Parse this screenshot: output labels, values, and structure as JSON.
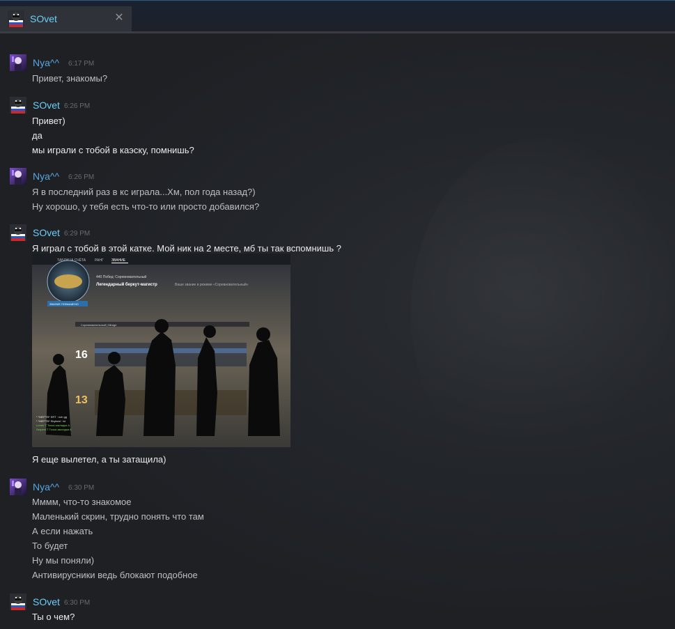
{
  "tab": {
    "name": "SOvet",
    "close_glyph": "✕",
    "avatar_icon": "sovet-avatar-icon"
  },
  "colors": {
    "nya_name": "#5aa6e0",
    "sovet_name": "#6dcff6",
    "background": "#1f2126"
  },
  "messages": [
    {
      "author": "Nya^^",
      "time": "6:17 PM",
      "lines": [
        "Привет, знакомы?"
      ]
    },
    {
      "author": "SOvet",
      "time": "6:26 PM",
      "lines": [
        "Привет)",
        "да",
        "мы играли с тобой в каэску, помнишь?"
      ]
    },
    {
      "author": "Nya^^",
      "time": "6:26 PM",
      "lines": [
        "Я в последний раз в кс играла...Хм, пол года назад?)",
        "Ну хорошо, у тебя есть что-то или просто добавился?"
      ]
    },
    {
      "author": "SOvet",
      "time": "6:29 PM",
      "lines": [
        "Я играл с тобой в этой катке. Мой ник на 2 месте, мб ты так вспомнишь ?"
      ],
      "screenshot": {
        "tabs": [
          "ТАБЛИЦА СЧЁТА",
          "РАНГ",
          "ЗВАНИЕ"
        ],
        "wins_label": "440 Побед: Соревновательный",
        "rank_title": "Легендарный беркут-магистр",
        "rank_subtitle": "Ваше звание в режиме «Соревновательный»",
        "rank_button": "ЗВАНИЕ ПОВЫШЕНО",
        "mode_label": "Соревновательный | Mirage",
        "score_top": "16",
        "score_bottom": "13",
        "chat_lines": [
          "* *MEPTB* SRT : noh gg",
          "* *MEPTB* Skyland : lol",
          "Lomer Т Точка закладки А",
          "Serpent Т Точка закладки А"
        ]
      },
      "after_lines": [
        "Я еще вылетел, а ты затащила)"
      ]
    },
    {
      "author": "Nya^^",
      "time": "6:30 PM",
      "lines": [
        "Мммм, что-то знакомое",
        "Маленький скрин, трудно понять что там",
        "А если нажать",
        "То будет",
        "Ну мы поняли)",
        "Антивирусники ведь блокают подобное"
      ]
    },
    {
      "author": "SOvet",
      "time": "6:30 PM",
      "lines": [
        "Ты о чем?"
      ]
    }
  ]
}
